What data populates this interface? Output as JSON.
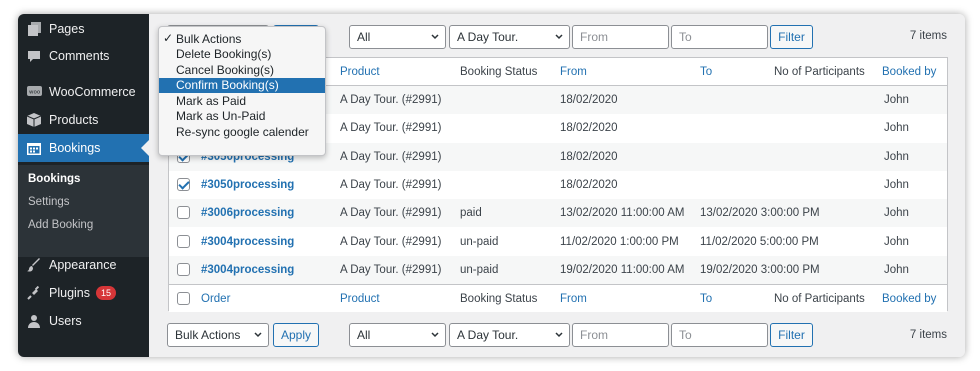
{
  "sidebar": {
    "items": [
      {
        "label": "Pages",
        "icon": "pages-icon"
      },
      {
        "label": "Comments",
        "icon": "comments-icon"
      },
      {
        "label": "WooCommerce",
        "icon": "woocommerce-icon"
      },
      {
        "label": "Products",
        "icon": "products-icon"
      },
      {
        "label": "Bookings",
        "icon": "calendar-icon"
      },
      {
        "label": "Appearance",
        "icon": "paintbrush-icon"
      },
      {
        "label": "Plugins",
        "icon": "plugin-icon",
        "badge": "15"
      },
      {
        "label": "Users",
        "icon": "users-icon"
      }
    ],
    "submenu": [
      "Bookings",
      "Settings",
      "Add Booking"
    ]
  },
  "toolbar": {
    "bulk_actions": "Bulk Actions",
    "apply": "Apply",
    "status_filter": "All",
    "product_filter": "A Day Tour.",
    "from_placeholder": "From",
    "to_placeholder": "To",
    "filter": "Filter",
    "item_count": "7 items"
  },
  "bulk_menu": {
    "selected": "Bulk Actions",
    "check": "✓",
    "options": [
      "Bulk Actions",
      "Delete Booking(s)",
      "Cancel Booking(s)",
      "Confirm Booking(s)",
      "Mark as Paid",
      "Mark as Un-Paid",
      "Re-sync google calender"
    ],
    "highlighted_index": 3
  },
  "table": {
    "columns": [
      "Order",
      "Product",
      "Booking Status",
      "From",
      "To",
      "No of Participants",
      "Booked by"
    ],
    "rows": [
      {
        "checked": false,
        "order": "",
        "product": "A Day Tour. (#2991)",
        "status": "",
        "from": "18/02/2020",
        "to": "",
        "participants": "",
        "booked_by": "John"
      },
      {
        "checked": false,
        "order": "",
        "product": "A Day Tour. (#2991)",
        "status": "",
        "from": "18/02/2020",
        "to": "",
        "participants": "",
        "booked_by": "John"
      },
      {
        "checked": true,
        "order": "#3050processing",
        "product": "A Day Tour. (#2991)",
        "status": "",
        "from": "18/02/2020",
        "to": "",
        "participants": "",
        "booked_by": "John"
      },
      {
        "checked": true,
        "order": "#3050processing",
        "product": "A Day Tour. (#2991)",
        "status": "",
        "from": "18/02/2020",
        "to": "",
        "participants": "",
        "booked_by": "John"
      },
      {
        "checked": false,
        "order": "#3006processing",
        "product": "A Day Tour. (#2991)",
        "status": "paid",
        "from": "13/02/2020 11:00:00 AM",
        "to": "13/02/2020 3:00:00 PM",
        "participants": "",
        "booked_by": "John"
      },
      {
        "checked": false,
        "order": "#3004processing",
        "product": "A Day Tour. (#2991)",
        "status": "un-paid",
        "from": "11/02/2020 1:00:00 PM",
        "to": "11/02/2020 5:00:00 PM",
        "participants": "",
        "booked_by": "John"
      },
      {
        "checked": false,
        "order": "#3004processing",
        "product": "A Day Tour. (#2991)",
        "status": "un-paid",
        "from": "19/02/2020 11:00:00 AM",
        "to": "19/02/2020 3:00:00 PM",
        "participants": "",
        "booked_by": "John"
      }
    ]
  },
  "colors": {
    "sidebar_bg": "#1d2327",
    "accent": "#2271b1",
    "badge": "#d63638"
  }
}
